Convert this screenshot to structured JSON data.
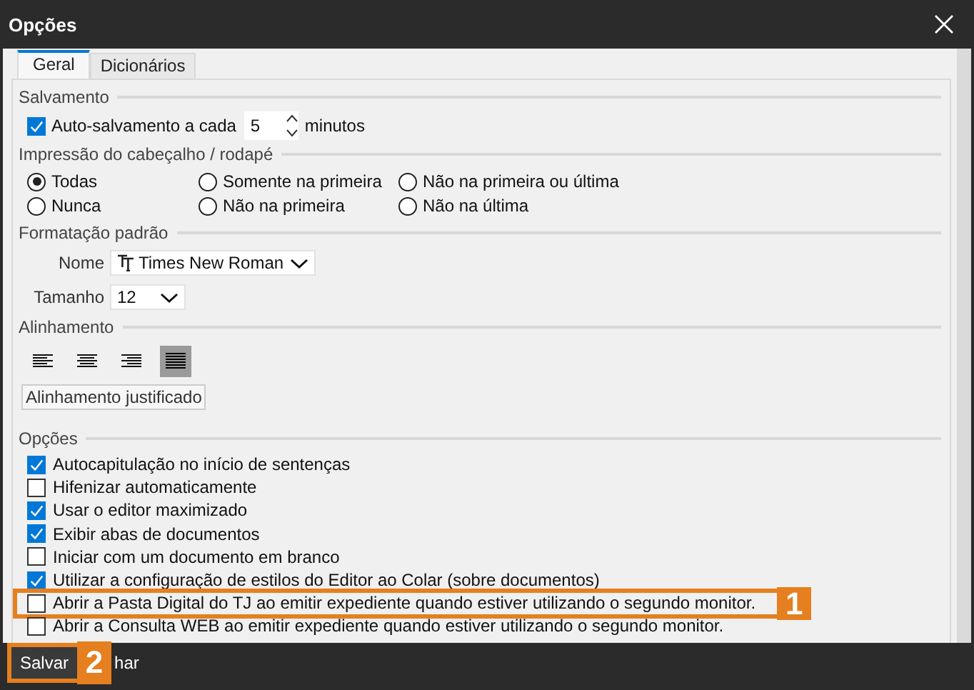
{
  "window": {
    "title": "Opções"
  },
  "tabs": [
    {
      "label": "Geral",
      "selected": true
    },
    {
      "label": "Dicionários",
      "selected": false
    }
  ],
  "salvamento": {
    "heading": "Salvamento",
    "label": "Auto-salvamento a cada",
    "checked": true,
    "value": "5",
    "unit": "minutos"
  },
  "impressao": {
    "heading": "Impressão do cabeçalho / rodapé",
    "options": [
      {
        "label": "Todas",
        "selected": true
      },
      {
        "label": "Somente na primeira",
        "selected": false
      },
      {
        "label": "Não na primeira ou última",
        "selected": false
      },
      {
        "label": "Nunca",
        "selected": false
      },
      {
        "label": "Não na primeira",
        "selected": false
      },
      {
        "label": "Não na última",
        "selected": false
      }
    ]
  },
  "formatacao": {
    "heading": "Formatação padrão",
    "fields": [
      {
        "label": "Nome",
        "value": "Times New Roman",
        "kind": "font"
      },
      {
        "label": "Tamanho",
        "value": "12",
        "kind": "plain"
      }
    ]
  },
  "alinhamento": {
    "heading": "Alinhamento",
    "buttons": [
      {
        "kind": "left",
        "selected": false
      },
      {
        "kind": "center",
        "selected": false
      },
      {
        "kind": "right",
        "selected": false
      },
      {
        "kind": "justify",
        "selected": true
      }
    ],
    "tooltip": "Alinhamento justificado"
  },
  "opcoes": {
    "heading": "Opções",
    "items": [
      {
        "label": "Autocapitulação no início de sentenças",
        "checked": true
      },
      {
        "label": "Hifenizar automaticamente",
        "checked": false
      },
      {
        "label": "Usar o editor maximizado",
        "checked": true
      },
      {
        "label": "Exibir abas de documentos",
        "checked": true
      },
      {
        "label": "Iniciar com um documento em branco",
        "checked": false
      },
      {
        "label": "Utilizar a configuração de estilos do Editor ao Colar (sobre documentos)",
        "checked": true
      },
      {
        "label": "Abrir a Pasta Digital do TJ ao emitir expediente quando estiver utilizando o segundo monitor.",
        "checked": false,
        "highlight": "1"
      },
      {
        "label": "Abrir a Consulta WEB ao emitir expediente quando estiver utilizando o segundo monitor.",
        "checked": false
      }
    ]
  },
  "buttons": [
    {
      "label": "Salvar",
      "highlight": "2"
    },
    {
      "label": "har"
    }
  ]
}
